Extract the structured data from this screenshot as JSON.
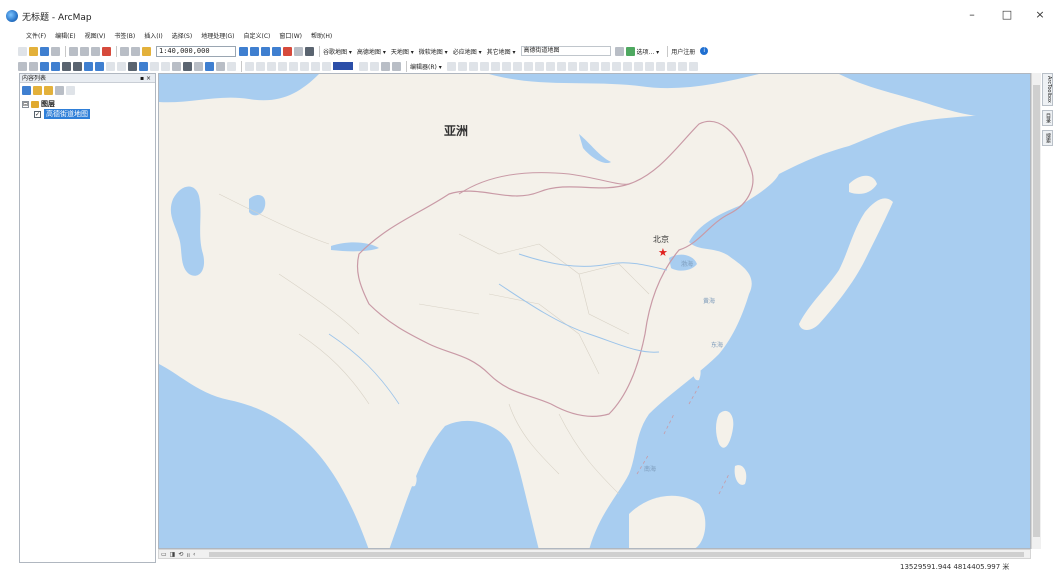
{
  "window": {
    "title": "无标题 - ArcMap",
    "buttons": {
      "minimize": "–",
      "maximize": "□",
      "close": "×"
    }
  },
  "menubar": [
    "文件(F)",
    "编辑(E)",
    "视图(V)",
    "书签(B)",
    "插入(I)",
    "选择(S)",
    "地理处理(G)",
    "自定义(C)",
    "窗口(W)",
    "帮助(H)"
  ],
  "toolbar1": {
    "scale": "1:40,000,000",
    "dropdowns": [
      "谷歌地图 ▾",
      "高德地图 ▾",
      "天地图 ▾",
      "微软地图 ▾",
      "必应地图 ▾",
      "其它地图 ▾"
    ],
    "current_basemap": "高德街道地图",
    "options_label": "选项... ▾",
    "user_label": "用户注册"
  },
  "toolbar2": {
    "editor_label": "编辑器(R) ▾",
    "color": "#2b4ea8"
  },
  "toc": {
    "title": "内容列表",
    "pin": "▪ ×",
    "group_label": "图层",
    "layer_label": "高德街道地图",
    "expander": "⊟"
  },
  "map": {
    "region_label": "亚洲",
    "capital_label": "北京",
    "capital_marker": "★",
    "seas": {
      "bohai": "渤海",
      "huanghai": "黄海",
      "donghai": "东海",
      "nanhai": "南海"
    },
    "colors": {
      "water": "#a8cdf0",
      "land": "#f4f1ea",
      "border": "#c99aa6",
      "river": "#9cc4ea"
    }
  },
  "bottom": {
    "layout_buttons": [
      "▭",
      "◨",
      "⟲",
      "॥",
      "‹"
    ],
    "coordinates": "13529591.944  4814405.997 米"
  },
  "dock": {
    "tabs": [
      "ArcToolbox",
      "目录",
      "搜索"
    ]
  }
}
